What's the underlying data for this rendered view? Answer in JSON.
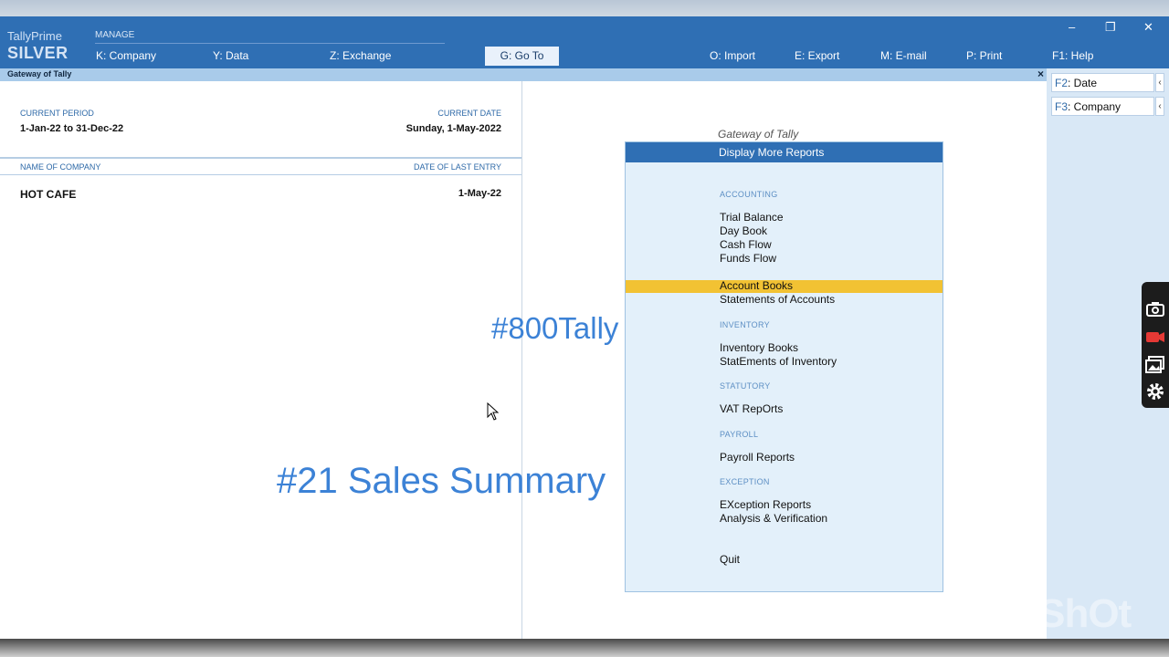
{
  "app": {
    "name": "TallyPrime",
    "edition": "SILVER"
  },
  "header": {
    "manage_label": "MANAGE",
    "menu": [
      {
        "key": "K",
        "label": ": Company"
      },
      {
        "key": "Y",
        "label": ": Data"
      },
      {
        "key": "Z",
        "label": ": Exchange"
      },
      {
        "key": "O",
        "label": ": Import"
      },
      {
        "key": "E",
        "label": ": Export"
      },
      {
        "key": "M",
        "label": ": E-mail"
      },
      {
        "key": "P",
        "label": ": Print"
      },
      {
        "key": "F1",
        "label": ": Help"
      }
    ],
    "goto": {
      "key": "G",
      "label": ": Go To"
    },
    "window_controls": {
      "minimize": "–",
      "restore": "❐",
      "close": "✕"
    }
  },
  "titlebar": {
    "title": "Gateway of Tally",
    "close": "×"
  },
  "company_info": {
    "current_period_label": "CURRENT PERIOD",
    "current_period": "1-Jan-22 to 31-Dec-22",
    "current_date_label": "CURRENT DATE",
    "current_date": "Sunday, 1-May-2022",
    "name_col": "NAME OF COMPANY",
    "date_col": "DATE OF LAST ENTRY",
    "companies": [
      {
        "name": "HOT CAFE",
        "last_entry": "1-May-22"
      }
    ]
  },
  "gateway": {
    "title": "Gateway of Tally",
    "header": "Display More Reports",
    "sections": {
      "accounting": "ACCOUNTING",
      "inventory": "INVENTORY",
      "statutory": "STATUTORY",
      "payroll": "PAYROLL",
      "exception": "EXCEPTION"
    },
    "items": {
      "trial_balance": {
        "pre": "",
        "key": "T",
        "post": "rial Balance"
      },
      "day_book": {
        "pre": "",
        "key": "D",
        "post": "ay Book"
      },
      "cash_flow": {
        "pre": "",
        "key": "C",
        "post": "ash Flow"
      },
      "funds_flow": {
        "pre": "",
        "key": "F",
        "post": "unds Flow"
      },
      "account_books": {
        "pre": "",
        "key": "A",
        "post": "ccount Books"
      },
      "statements_accounts": {
        "pre": "",
        "key": "S",
        "post": "tatements of Accounts"
      },
      "inventory_books": {
        "pre": "",
        "key": "I",
        "post": "nventory Books"
      },
      "statements_inventory": {
        "pre": "Stat",
        "key": "E",
        "post": "ments of Inventory"
      },
      "vat_reports": {
        "pre": "VAT Rep",
        "key": "O",
        "post": "rts"
      },
      "payroll_reports": {
        "pre": "",
        "key": "P",
        "post": "ayroll Reports"
      },
      "exception_reports": {
        "pre": "E",
        "key": "X",
        "post": "ception Reports"
      },
      "analysis_verification": {
        "pre": "Analysis & ",
        "key": "V",
        "post": "erification"
      },
      "quit": {
        "pre": "",
        "key": "Q",
        "post": "uit"
      }
    }
  },
  "sidebar": {
    "buttons": [
      {
        "key": "F2",
        "label": ": Date"
      },
      {
        "key": "F3",
        "label": ": Company"
      }
    ],
    "arrow": "‹"
  },
  "overlay": {
    "tag1": "#800Tally",
    "tag2": "#21 Sales Summary",
    "watermark": "InShOt"
  },
  "colors": {
    "header_blue": "#2f6fb4",
    "highlight": "#f2c233",
    "panel_bg": "#e3f0fa",
    "overlay_text": "#3c82d6"
  }
}
